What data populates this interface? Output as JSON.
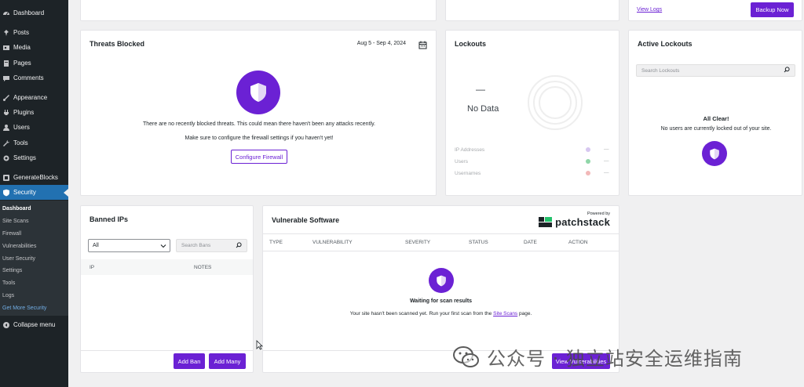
{
  "sidebar": {
    "items": [
      {
        "label": "Dashboard",
        "icon": "dashboard-icon"
      },
      {
        "label": "Posts",
        "icon": "pin-icon"
      },
      {
        "label": "Media",
        "icon": "media-icon"
      },
      {
        "label": "Pages",
        "icon": "pages-icon"
      },
      {
        "label": "Comments",
        "icon": "comment-icon"
      },
      {
        "label": "Appearance",
        "icon": "brush-icon"
      },
      {
        "label": "Plugins",
        "icon": "plug-icon"
      },
      {
        "label": "Users",
        "icon": "user-icon"
      },
      {
        "label": "Tools",
        "icon": "wrench-icon"
      },
      {
        "label": "Settings",
        "icon": "settings-icon"
      },
      {
        "label": "GenerateBlocks",
        "icon": "blocks-icon"
      },
      {
        "label": "Security",
        "icon": "shield-icon"
      }
    ],
    "submenu": [
      "Dashboard",
      "Site Scans",
      "Firewall",
      "Vulnerabilities",
      "User Security",
      "Settings",
      "Tools",
      "Logs",
      "Get More Security"
    ],
    "collapse_label": "Collapse menu"
  },
  "top_row": {
    "view_logs": "View Logs",
    "backup_now": "Backup Now"
  },
  "threats": {
    "title": "Threats Blocked",
    "date_range": "Aug 5 - Sep 4, 2024",
    "message1": "There are no recently blocked threats. This could mean there haven't been any attacks recently.",
    "message2": "Make sure to configure the firewall settings if you haven't yet!",
    "button": "Configure Firewall"
  },
  "lockouts": {
    "title": "Lockouts",
    "dash": "—",
    "no_data": "No Data",
    "legend": [
      {
        "label": "IP Addresses",
        "value": "—",
        "color": "#d7c7f0"
      },
      {
        "label": "Users",
        "value": "—",
        "color": "#8fd6a8"
      },
      {
        "label": "Usernames",
        "value": "—",
        "color": "#f2b8b8"
      }
    ]
  },
  "active_lockouts": {
    "title": "Active Lockouts",
    "search_placeholder": "Search Lockouts",
    "all_clear": "All Clear!",
    "message": "No users are currently locked out of your site."
  },
  "banned": {
    "title": "Banned IPs",
    "filter_value": "All",
    "search_placeholder": "Search Bans",
    "col_ip": "IP",
    "col_notes": "NOTES",
    "add_ban": "Add Ban",
    "add_many": "Add Many"
  },
  "vuln": {
    "title": "Vulnerable Software",
    "powered_by": "Powered by",
    "brand": "patchstack",
    "columns": [
      "TYPE",
      "VULNERABILITY",
      "SEVERITY",
      "STATUS",
      "DATE",
      "ACTION"
    ],
    "waiting": "Waiting for scan results",
    "msg_prefix": "Your site hasn't been scanned yet. Run your first scan from the ",
    "msg_link": "Site Scans",
    "msg_suffix": " page.",
    "button": "View Vulnerabilities"
  },
  "watermark": "公众号 · 独立站安全运维指南"
}
